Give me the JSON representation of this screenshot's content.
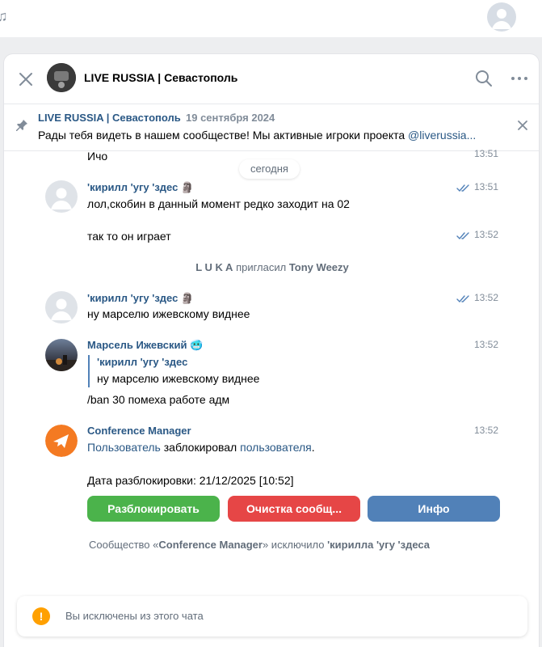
{
  "icons": {
    "music": "music-note-icon",
    "close": "close-icon",
    "search": "search-icon",
    "more": "more-horizontal-icon",
    "pin": "pin-icon",
    "read": "double-check-icon",
    "info": "info-icon"
  },
  "header": {
    "title": "LIVE RUSSIA | Севастополь"
  },
  "pinned": {
    "author": "LIVE RUSSIA | Севастополь",
    "date": "19 сентября 2024",
    "text_prefix": "Рады тебя видеть в нашем сообществе! Мы активные игроки проекта ",
    "mention": "@liverussia..."
  },
  "messages": {
    "m0": {
      "text": "Ичо",
      "time": "13:51"
    },
    "date_divider": "сегодня",
    "m1": {
      "author": "'кирилл 'угу 'здес 🗿",
      "text": "лол,скобин в данный момент редко заходит на 02",
      "time": "13:51"
    },
    "m2": {
      "text": "так то он играет",
      "time": "13:52"
    },
    "service1": {
      "actor": "L U K A",
      "action": " пригласил ",
      "target": "Tony Weezy"
    },
    "m3": {
      "author": "'кирилл 'угу 'здес 🗿",
      "text": "ну марселю ижевскому виднее",
      "time": "13:52"
    },
    "m4": {
      "author": "Марсель Ижевский 🥶",
      "time": "13:52",
      "quote_author": "'кирилл 'угу 'здес",
      "quote_text": "ну марселю ижевскому виднее",
      "text": "/ban 30 помеха работе адм"
    },
    "m5": {
      "author": "Conference Manager",
      "time": "13:52",
      "link1": "Пользователь",
      "mid": " заблокировал ",
      "link2": "пользователя",
      "end": ".",
      "unblock_date": "Дата разблокировки: 21/12/2025 [10:52]",
      "buttons": {
        "unblock": "Разблокировать",
        "clear": "Очистка сообщ...",
        "info": "Инфо"
      }
    },
    "service2": {
      "prefix": "Сообщество «",
      "community": "Conference Manager",
      "middle": "» исключило ",
      "target": "'кирилла 'угу 'здеса"
    }
  },
  "notice": {
    "icon_text": "!",
    "text": "Вы исключены из этого чата"
  },
  "colors": {
    "link": "#2a5885",
    "green": "#4bb34b",
    "red": "#e64646",
    "blue": "#5181b8",
    "warning": "#ffa000"
  }
}
